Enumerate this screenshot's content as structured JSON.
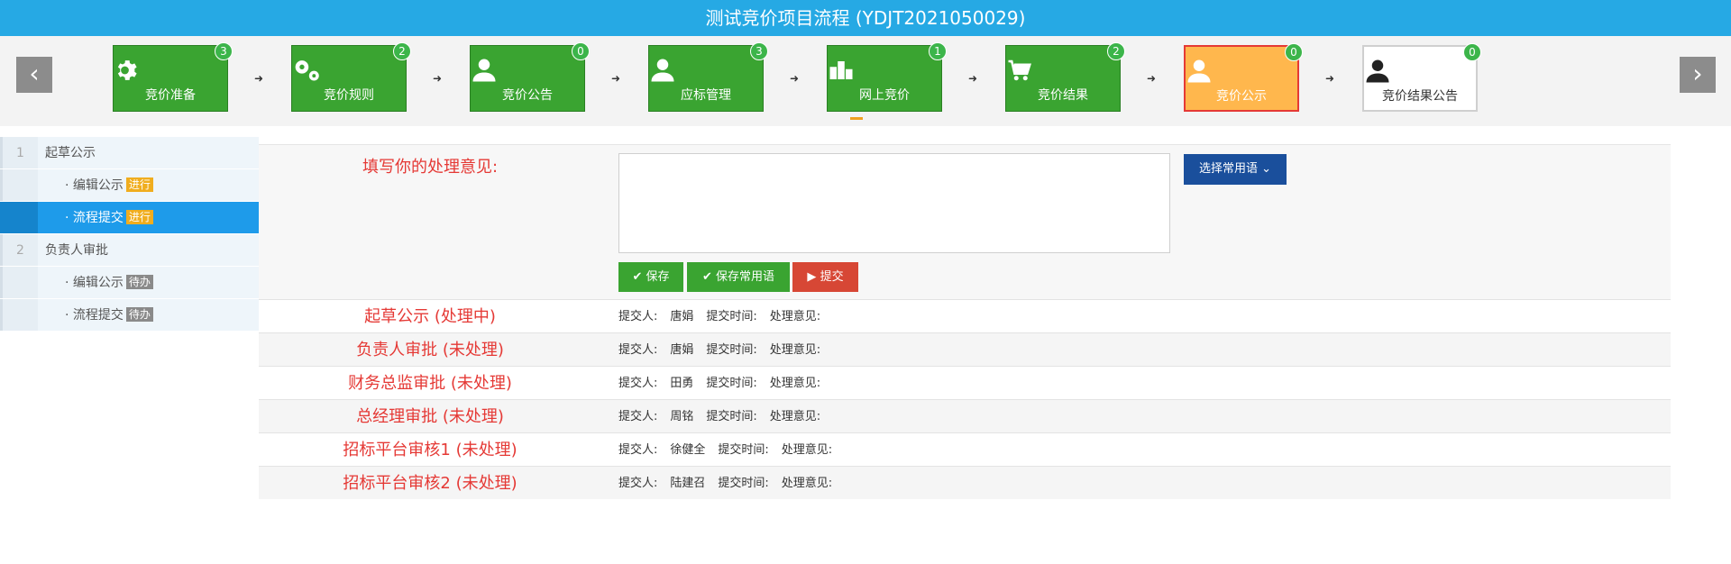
{
  "title": "测试竞价项目流程 (YDJT2021050029)",
  "nav": {
    "prev_glyph": "‹",
    "next_glyph": "›"
  },
  "steps": [
    {
      "label": "竞价准备",
      "badge": "3",
      "icon": "gear-icon"
    },
    {
      "label": "竞价规则",
      "badge": "2",
      "icon": "gears-icon"
    },
    {
      "label": "竞价公告",
      "badge": "0",
      "icon": "user-icon"
    },
    {
      "label": "应标管理",
      "badge": "3",
      "icon": "user-icon"
    },
    {
      "label": "网上竞价",
      "badge": "1",
      "icon": "bidding-icon"
    },
    {
      "label": "竞价结果",
      "badge": "2",
      "icon": "cart-icon"
    },
    {
      "label": "竞价公示",
      "badge": "0",
      "icon": "user-icon",
      "state": "active"
    },
    {
      "label": "竞价结果公告",
      "badge": "0",
      "icon": "user-icon",
      "state": "plain"
    }
  ],
  "sidebar": {
    "items": [
      {
        "num": "1",
        "label": "起草公示"
      },
      {
        "label": "· 编辑公示",
        "tag": "进行"
      },
      {
        "label": "· 流程提交",
        "tag": "进行"
      },
      {
        "num": "2",
        "label": "负责人审批"
      },
      {
        "label": "· 编辑公示",
        "tag": "待办"
      },
      {
        "label": "· 流程提交",
        "tag": "待办"
      }
    ]
  },
  "form": {
    "label": "填写你的处理意见:",
    "textarea_value": "",
    "save_label": "保存",
    "save_common_label": "保存常用语",
    "submit_label": "提交",
    "phrase_label": "选择常用语"
  },
  "records": [
    {
      "stage": "起草公示 (处理中)",
      "submitter_label": "提交人:",
      "submitter": "唐娟",
      "time_label": "提交时间:",
      "opinion_label": "处理意见:"
    },
    {
      "stage": "负责人审批 (未处理)",
      "submitter_label": "提交人:",
      "submitter": "唐娟",
      "time_label": "提交时间:",
      "opinion_label": "处理意见:"
    },
    {
      "stage": "财务总监审批 (未处理)",
      "submitter_label": "提交人:",
      "submitter": "田勇",
      "time_label": "提交时间:",
      "opinion_label": "处理意见:"
    },
    {
      "stage": "总经理审批 (未处理)",
      "submitter_label": "提交人:",
      "submitter": "周铭",
      "time_label": "提交时间:",
      "opinion_label": "处理意见:"
    },
    {
      "stage": "招标平台审核1 (未处理)",
      "submitter_label": "提交人:",
      "submitter": "徐健全",
      "time_label": "提交时间:",
      "opinion_label": "处理意见:"
    },
    {
      "stage": "招标平台审核2 (未处理)",
      "submitter_label": "提交人:",
      "submitter": "陆建召",
      "time_label": "提交时间:",
      "opinion_label": "处理意见:"
    }
  ]
}
